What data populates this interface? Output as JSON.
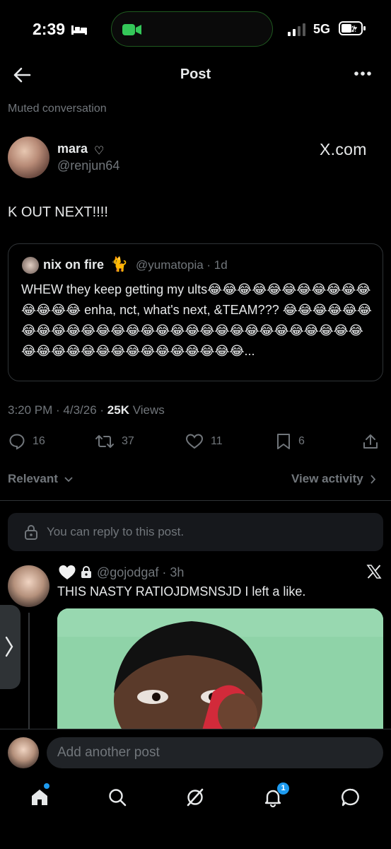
{
  "status_bar": {
    "time": "2:39",
    "network": "5G",
    "battery_level": "42"
  },
  "header": {
    "title": "Post"
  },
  "muted_label": "Muted conversation",
  "post": {
    "author_name": "mara",
    "author_name_symbol": "♡",
    "author_handle": "@renjun64",
    "source_badge": "X.com",
    "text": "K OUT NEXT!!!!",
    "quote": {
      "author_name": "nix on fire",
      "author_emoji": "🐈",
      "author_handle": "@yumatopia · 1d",
      "text": "WHEW they keep getting my ults😂😂😂😂😂😂😂😂😂😂😂😂😂😂😂 enha, nct, what's next, &TEAM??? 😂😂😂😂😂😂😂😂😂😂😂😂😂😂😂😂😂😂😂😂😂😂😂😂😂😂😂😂😂😂😂😂😂😂😂😂😂😂😂😂😂😂😂😂..."
    },
    "meta_time": "3:20 PM · 4/3/26 · ",
    "views_count": "25K",
    "views_label": " Views",
    "actions": {
      "replies": "16",
      "reposts": "37",
      "likes": "11",
      "bookmarks": "6"
    }
  },
  "sort": {
    "label": "Relevant",
    "view_activity": "View activity"
  },
  "reply_info": "You can reply to this post.",
  "reply": {
    "handle": "@gojodgaf · 3h",
    "text": "THIS NASTY RATIOJDMSNSJD I left a like."
  },
  "composer": {
    "placeholder": "Add another post"
  },
  "nav": {
    "notifications_badge": "1"
  },
  "colors": {
    "accent": "#1d9bf0",
    "background": "#000000",
    "secondary_text": "#71767b",
    "border": "#2f3336"
  }
}
